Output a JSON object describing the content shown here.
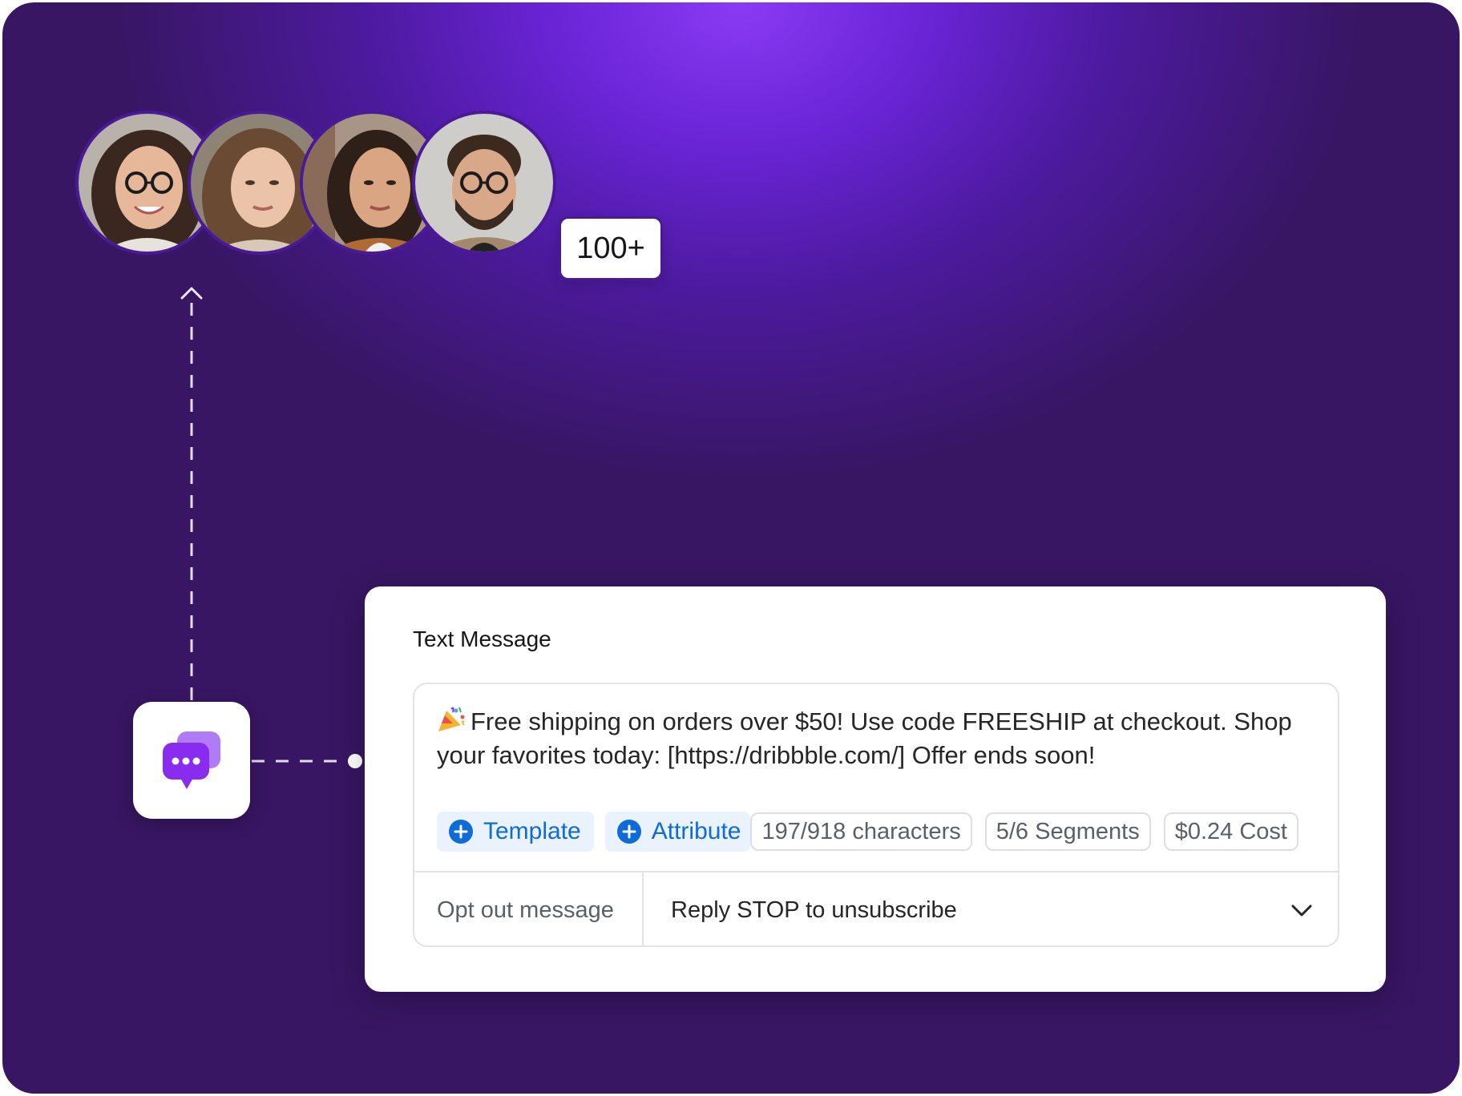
{
  "audience": {
    "count_label": "100+",
    "avatars": [
      {
        "name": "avatar-woman-glasses"
      },
      {
        "name": "avatar-woman-wavy-hair"
      },
      {
        "name": "avatar-woman-street"
      },
      {
        "name": "avatar-man-glasses"
      }
    ]
  },
  "app_icon": {
    "icon": "chat-bubbles-icon",
    "color": "#8a2bf0"
  },
  "card": {
    "title": "Text Message",
    "message": {
      "emoji": "party-popper-icon",
      "text": "Free shipping on orders over $50! Use code FREESHIP at checkout. Shop your favorites today: [https://dribbble.com/] Offer ends soon!"
    },
    "actions": {
      "template_label": "Template",
      "attribute_label": "Attribute"
    },
    "stats": {
      "characters": "197/918 characters",
      "segments": "5/6 Segments",
      "cost": "$0.24 Cost"
    },
    "optout": {
      "label": "Opt out message",
      "value": "Reply STOP to unsubscribe"
    }
  },
  "colors": {
    "background_dark": "#381663",
    "background_glow": "#8a3bf4",
    "accent_blue": "#0f6bd8",
    "chip_bg": "#e9f2fd"
  }
}
